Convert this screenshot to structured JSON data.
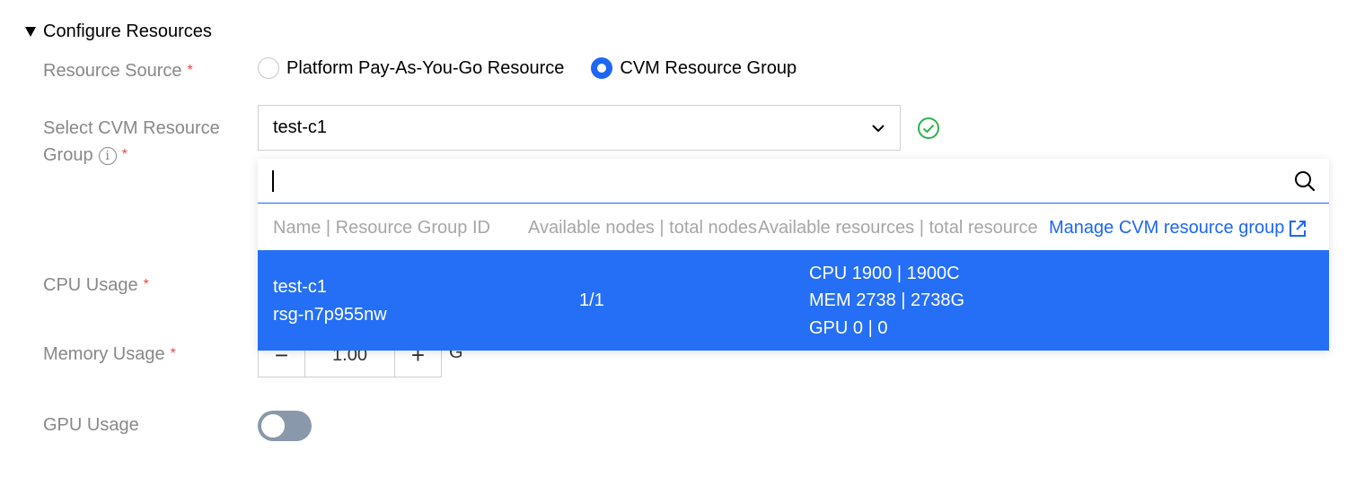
{
  "section": {
    "title": "Configure Resources"
  },
  "fields": {
    "resource_source": {
      "label": "Resource Source",
      "required": "*"
    },
    "select_group": {
      "label_line1": "Select CVM Resource",
      "label_line2": "Group",
      "info": "i",
      "required": "*"
    },
    "cpu": {
      "label": "CPU Usage",
      "required": "*"
    },
    "memory": {
      "label": "Memory Usage",
      "required": "*",
      "value": "1.00",
      "unit": "G",
      "decrement": "−",
      "increment": "+"
    },
    "gpu": {
      "label": "GPU Usage",
      "enabled": false
    }
  },
  "radio_options": [
    {
      "label": "Platform Pay-As-You-Go Resource",
      "checked": false
    },
    {
      "label": "CVM Resource Group",
      "checked": true
    }
  ],
  "select": {
    "value": "test-c1",
    "status_icon": "check-circle-icon"
  },
  "dropdown": {
    "search_value": "",
    "columns": [
      "Name | Resource Group ID",
      "Available nodes | total nodes",
      "Available resources | total resource",
      "Manage CVM resource group"
    ],
    "rows": [
      {
        "name": "test-c1",
        "id": "rsg-n7p955nw",
        "nodes": "1/1",
        "cpu": "CPU 1900 | 1900C",
        "mem": "MEM 2738 | 2738G",
        "gpu": "GPU 0 | 0",
        "selected": true
      }
    ]
  },
  "colors": {
    "accent": "#1e66f5",
    "selected_row": "#256ff6",
    "success": "#2bb24c",
    "required": "#e54545",
    "label": "#888888"
  }
}
